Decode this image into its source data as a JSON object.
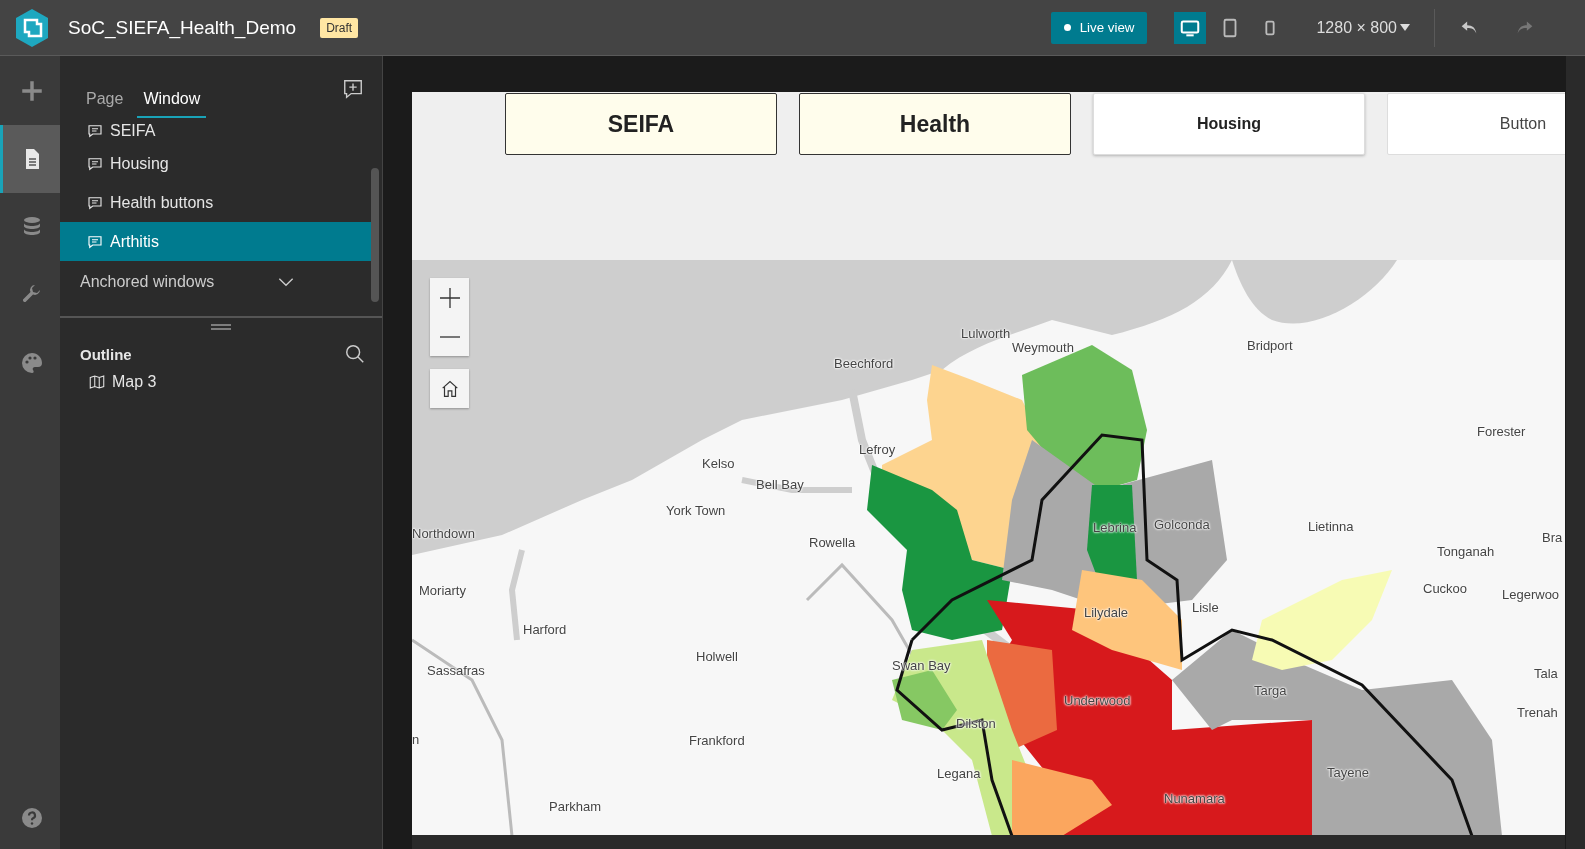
{
  "app": {
    "title": "SoC_SIEFA_Health_Demo",
    "status_badge": "Draft",
    "live_view": "Live view",
    "devices": [
      {
        "kind": "desktop",
        "selected": true
      },
      {
        "kind": "tablet",
        "selected": false
      },
      {
        "kind": "phone",
        "selected": false
      }
    ],
    "resolution": "1280 × 800",
    "undo": {
      "disabled": false
    },
    "redo": {
      "disabled": true
    }
  },
  "rail": [
    {
      "kind": "add",
      "selected": false
    },
    {
      "kind": "page",
      "selected": true
    },
    {
      "kind": "data",
      "selected": false
    },
    {
      "kind": "tools",
      "selected": false
    },
    {
      "kind": "theme",
      "selected": false
    },
    {
      "kind": "help",
      "selected": false
    }
  ],
  "panel": {
    "tabs": [
      {
        "label": "Page",
        "selected": false
      },
      {
        "label": "Window",
        "selected": true
      }
    ],
    "windows": [
      {
        "label": "SEIFA",
        "selected": false
      },
      {
        "label": "Housing",
        "selected": false
      },
      {
        "label": "Health buttons",
        "selected": false
      },
      {
        "label": "Arthitis",
        "selected": true
      }
    ],
    "anchored": {
      "label": "Anchored windows",
      "expanded": false
    },
    "outline": {
      "title": "Outline",
      "items": [
        {
          "label": "Map 3"
        }
      ]
    }
  },
  "preview": {
    "buttons": [
      {
        "label": "SEIFA",
        "kind": "highlighted"
      },
      {
        "label": "Health",
        "kind": "highlighted"
      },
      {
        "label": "Housing",
        "kind": "bold"
      },
      {
        "label": "Button",
        "kind": "default"
      }
    ],
    "map": {
      "places": [
        "Lulworth",
        "Weymouth",
        "Beechford",
        "Bridport",
        "Forester",
        "Lefroy",
        "Kelso",
        "Bell Bay",
        "York Town",
        "Lebrina",
        "Golconda",
        "Lietinna",
        "Northdown",
        "Rowella",
        "Tonganah",
        "Bra",
        "Moriarty",
        "Cuckoo",
        "Legerwoo",
        "Lisle",
        "Lilydale",
        "Harford",
        "Holwell",
        "Sassafras",
        "Swan Bay",
        "Targa",
        "Tala",
        "Underwood",
        "Dilston",
        "Trenah",
        "n",
        "Frankford",
        "Legana",
        "Tayene",
        "Parkham",
        "Nunamara"
      ]
    }
  }
}
